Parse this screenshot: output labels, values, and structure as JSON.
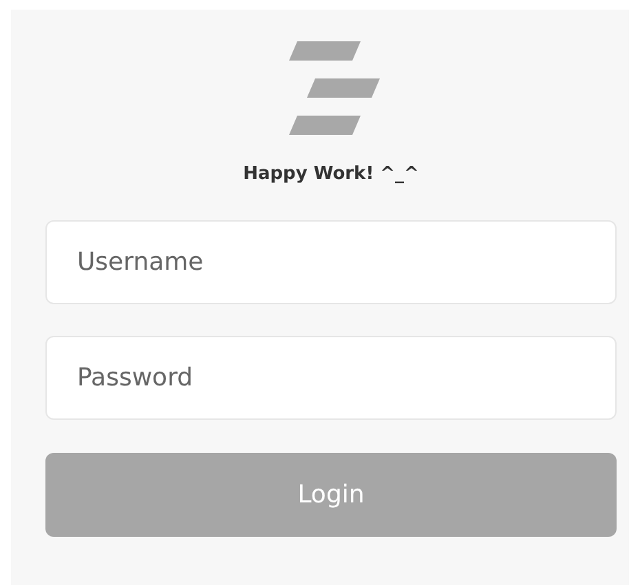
{
  "app": {
    "tagline": "Happy Work! ^_^"
  },
  "fields": [
    {
      "placeholder": "Username"
    },
    {
      "placeholder": "Password"
    }
  ],
  "login_button": {
    "label": "Login",
    "disabled": true
  }
}
